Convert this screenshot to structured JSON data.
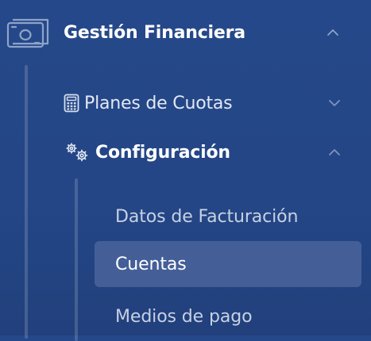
{
  "theme": {
    "background": "#25488a",
    "active_item_bg": "#445f98",
    "text_primary": "#ffffff",
    "text_secondary": "#c7d1e3"
  },
  "sidebar": {
    "section": {
      "label": "Gestión Financiera",
      "icon": "money-icon",
      "expanded": true,
      "items": [
        {
          "label": "Planes de Cuotas",
          "icon": "calculator-icon",
          "expanded": false
        },
        {
          "label": "Configuración",
          "icon": "gears-icon",
          "expanded": true,
          "items": [
            {
              "label": "Datos de Facturación",
              "active": false
            },
            {
              "label": "Cuentas",
              "active": true
            },
            {
              "label": "Medios de pago",
              "active": false
            }
          ]
        }
      ]
    }
  }
}
